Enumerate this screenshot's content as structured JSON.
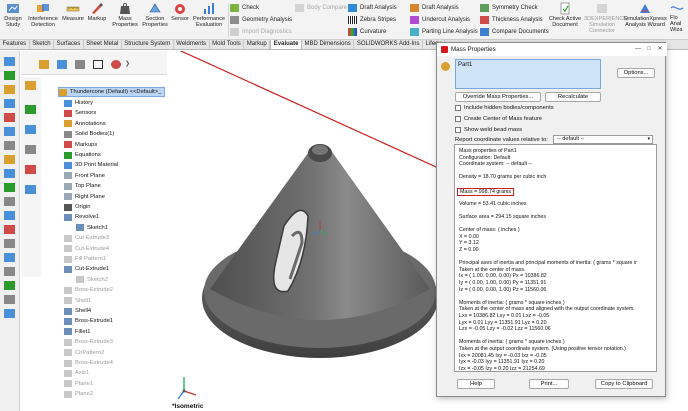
{
  "ribbon": {
    "big_buttons": [
      {
        "label": "Design\nStudy",
        "icon": "design-study-icon"
      },
      {
        "label": "Interference\nDetection",
        "icon": "interference-icon"
      },
      {
        "label": "Measure",
        "icon": "measure-icon"
      },
      {
        "label": "Markup",
        "icon": "markup-icon"
      },
      {
        "label": "Mass\nProperties",
        "icon": "mass-properties-icon"
      },
      {
        "label": "Section\nProperties",
        "icon": "section-properties-icon"
      },
      {
        "label": "Sensor",
        "icon": "sensor-icon"
      },
      {
        "label": "Performance\nEvaluation",
        "icon": "performance-icon"
      }
    ],
    "small_col1": [
      "Check",
      "Geometry Analysis",
      "Import Diagnostics"
    ],
    "small_col2": [
      "Body Compare"
    ],
    "small_col3": [
      "Draft Analysis",
      "Zebra Stripes",
      "Curvature"
    ],
    "small_col4": [
      "Draft Analysis",
      "Undercut Analysis",
      "Parting Line Analysis"
    ],
    "small_col5": [
      "Symmetry Check",
      "Thickness Analysis",
      "Compare Documents"
    ],
    "check_active": "Check Active\nDocument",
    "right_buttons": [
      "3DEXPERIENCE\nSimulation\nConnector",
      "SimulationXpress\nAnalysis Wizard",
      "Flo\nAnal\nWiza"
    ]
  },
  "tabs": [
    "Features",
    "Sketch",
    "Surfaces",
    "Sheet Metal",
    "Structure System",
    "Weldments",
    "Mold Tools",
    "Markup",
    "Evaluate",
    "MBD Dimensions",
    "SOLIDWORKS Add-Ins",
    "Lifecy"
  ],
  "active_tab": "Evaluate",
  "tree": {
    "root": "Thundercone (Default) <<Default>_",
    "items": [
      {
        "label": "History",
        "gray": false
      },
      {
        "label": "Sensors",
        "gray": false
      },
      {
        "label": "Annotations",
        "gray": false
      },
      {
        "label": "Solid Bodies(1)",
        "gray": false
      },
      {
        "label": "Markups",
        "gray": false
      },
      {
        "label": "Equations",
        "gray": false
      },
      {
        "label": "3D Print Material",
        "gray": false
      },
      {
        "label": "Front Plane",
        "gray": false
      },
      {
        "label": "Top Plane",
        "gray": false
      },
      {
        "label": "Right Plane",
        "gray": false
      },
      {
        "label": "Origin",
        "gray": false
      },
      {
        "label": "Revolve1",
        "gray": false
      },
      {
        "label": "Sketch1",
        "gray": false
      },
      {
        "label": "Cut-Extrude3",
        "gray": true
      },
      {
        "label": "Cut-Extrude4",
        "gray": true
      },
      {
        "label": "Fill Pattern1",
        "gray": true
      },
      {
        "label": "Cut-Extrude1",
        "gray": false
      },
      {
        "label": "Sketch2",
        "gray": true
      },
      {
        "label": "Boss-Extrude2",
        "gray": true
      },
      {
        "label": "Shell1",
        "gray": true
      },
      {
        "label": "Shell4",
        "gray": false
      },
      {
        "label": "Boss-Extrude1",
        "gray": false
      },
      {
        "label": "Fillet1",
        "gray": false
      },
      {
        "label": "Boss-Extrude3",
        "gray": true
      },
      {
        "label": "CirPattern2",
        "gray": true
      },
      {
        "label": "Boss-Extrude4",
        "gray": true
      },
      {
        "label": "Axis1",
        "gray": true
      },
      {
        "label": "Plane1",
        "gray": true
      },
      {
        "label": "Plane2",
        "gray": true
      }
    ]
  },
  "viewport": {
    "view_label": "*Isometric"
  },
  "dialog": {
    "title": "Mass Properties",
    "selection": "Part1",
    "options_button": "Options...",
    "override_button": "Override Mass Properties...",
    "recalculate_button": "Recalculate",
    "checkboxes": [
      "Include hidden bodies/components",
      "Create Center of Mass feature",
      "Show weld bead mass"
    ],
    "report_label": "Report coordinate values relative to:",
    "report_value": "-- default --",
    "results": [
      "Mass properties of Part1",
      "     Configuration: Default",
      "     Coordinate system: -- default --",
      "",
      "Density = 18.70 grams per cubic inch",
      "",
      "Mass = 998.74 grams",
      "",
      "Volume = 53.41 cubic inches",
      "",
      "Surface area = 294.15 square inches",
      "",
      "Center of mass: ( inches )",
      "     X = 0.00",
      "     Y = 3.12",
      "     Z = 0.00",
      "",
      "Principal axes of inertia and principal moments of inertia: ( grams * square ir",
      "Taken at the center of mass.",
      "     Ix = ( 1.00,  0.00,  0.00)      Px = 10386.82",
      "     Iy = ( 0.00,  1.00,  0.00)      Py = 11351.91",
      "     Iz = ( 0.00,  0.00,  1.00)      Pz = 11560.06",
      "",
      "Moments of inertia: ( grams * square inches )",
      "Taken at the center of mass and aligned with the output coordinate system.",
      "     Lxx = 10386.82        Lxy = 0.01          Lxz = -0.05",
      "     Lyx = 0.01            Lyy = 11351.91      Lyz = 0.20",
      "     Lzx = -0.05           Lzy = -0.02         Lzz = 11560.06",
      "",
      "Moments of inertia: ( grams * square inches )",
      "Taken at the output coordinate system. (Using positive tensor notation.)",
      "     Ixx = 20081.45        Ixy = -0.03         Ixz = -0.05",
      "     Iyx = -0.03           Iyy = 11351.91      Iyz = 0.20",
      "     Izx = -0.05           Izy = 0.20          Izz = 21254.69"
    ],
    "help_button": "Help",
    "print_button": "Print...",
    "copy_button": "Copy to Clipboard"
  },
  "colors": {
    "annotation_red": "#cc1f1f",
    "selection_blue": "#bcd5f2",
    "tab_active": "#ffffff"
  }
}
